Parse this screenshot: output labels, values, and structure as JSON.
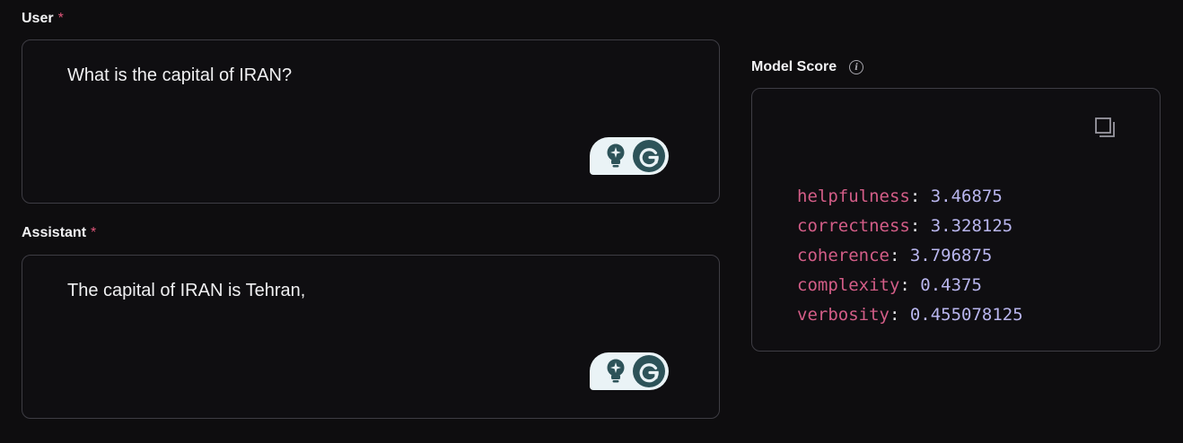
{
  "user": {
    "label": "User",
    "required_mark": "*",
    "text": "What is the capital of IRAN?"
  },
  "assistant": {
    "label": "Assistant",
    "required_mark": "*",
    "text": "The capital of IRAN is Tehran,"
  },
  "grammarly_widget": {
    "icons": [
      "lightbulb-icon",
      "grammarly-g-icon"
    ]
  },
  "model_score": {
    "label": "Model Score",
    "info_icon": "info-icon",
    "copy_icon": "copy-icon",
    "scores": [
      {
        "key": "helpfulness",
        "value": "3.46875"
      },
      {
        "key": "correctness",
        "value": "3.328125"
      },
      {
        "key": "coherence",
        "value": "3.796875"
      },
      {
        "key": "complexity",
        "value": "0.4375"
      },
      {
        "key": "verbosity",
        "value": "0.455078125"
      }
    ]
  },
  "colors": {
    "background": "#0e0d0f",
    "required": "#e0567a",
    "json_key": "#d35d87",
    "json_value": "#b9b6ee",
    "grammarly_bg": "#eaf3f6",
    "grammarly_g": "#2d5359"
  }
}
